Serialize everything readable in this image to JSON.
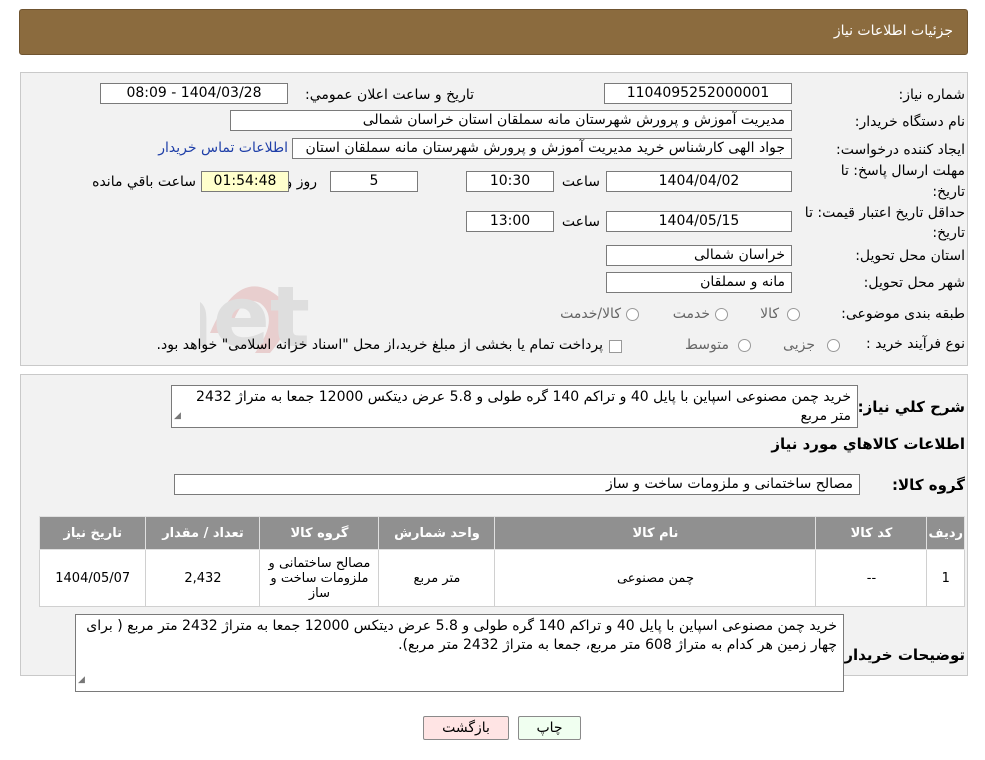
{
  "header": {
    "title": "جزئیات اطلاعات نیاز"
  },
  "need_number": {
    "label": "شماره نیاز:",
    "value": "1104095252000001"
  },
  "announce_datetime": {
    "label": "تاریخ و ساعت اعلان عمومي:",
    "value": "1404/03/28 - 08:09"
  },
  "buyer_org": {
    "label": "نام دستگاه خريدار:",
    "value": "مدیریت آموزش و پرورش شهرستان مانه سملقان استان خراسان شمالی"
  },
  "requester": {
    "label": "ایجاد کننده درخواست:",
    "value": "جواد الهی کارشناس خرید مدیریت آموزش و پرورش شهرستان مانه سملقان استان",
    "contact_link": "اطلاعات تماس خریدار"
  },
  "reply_deadline": {
    "label_line1": "مهلت ارسال پاسخ: تا",
    "label_line2": "تاریخ:",
    "date": "1404/04/02",
    "time_label": "ساعت",
    "time": "10:30",
    "days": "5",
    "days_label": "روز و",
    "remaining": "01:54:48",
    "remaining_label": "ساعت باقي مانده"
  },
  "price_validity": {
    "label_line1": "حداقل تاریخ اعتبار قیمت: تا",
    "label_line2": "تاریخ:",
    "date": "1404/05/15",
    "time_label": "ساعت",
    "time": "13:00"
  },
  "delivery_province": {
    "label": "استان محل تحویل:",
    "value": "خراسان شمالی"
  },
  "delivery_city": {
    "label": "شهر محل تحویل:",
    "value": "مانه و سملقان"
  },
  "category": {
    "label": "طبقه بندی موضوعی:",
    "options": [
      "کالا",
      "خدمت",
      "کالا/خدمت"
    ]
  },
  "purchase_process": {
    "label": "نوع فرآیند خرید :",
    "options": [
      "جزیی",
      "متوسط"
    ],
    "note": "پرداخت تمام یا بخشی از مبلغ خرید،از محل \"اسناد خزانه اسلامی\" خواهد بود."
  },
  "general_description": {
    "label": "شرح کلي نياز:",
    "value": "خرید چمن مصنوعی اسپاین با پایل 40 و تراکم 140 گره طولی و 5.8 عرض دیتکس 12000 جمعا به متراژ 2432 متر مربع"
  },
  "items_section_title": "اطلاعات کالاهاي مورد نياز",
  "goods_group": {
    "label": "گروه کالا:",
    "value": "مصالح ساختمانی و ملزومات ساخت و ساز"
  },
  "table": {
    "headers": [
      "رديف",
      "کد کالا",
      "نام کالا",
      "واحد شمارش",
      "گروه کالا",
      "تعداد / مقدار",
      "تاريخ نياز"
    ],
    "rows": [
      [
        "1",
        "--",
        "چمن مصنوعی",
        "متر مربع",
        "مصالح ساختمانی و ملزومات ساخت و ساز",
        "2,432",
        "1404/05/07"
      ]
    ]
  },
  "buyer_notes": {
    "label": "توضیحات خریدار:",
    "value": "خرید چمن مصنوعی اسپاین با پایل 40 و تراکم 140 گره طولی و 5.8 عرض دیتکس 12000 جمعا به متراژ 2432 متر مربع ( برای چهار زمین هر کدام به متراژ 608 متر مربع، جمعا به متراژ 2432 متر مربع)."
  },
  "buttons": {
    "print": "چاپ",
    "back": "بازگشت"
  },
  "watermark_text": "AriaTender.net",
  "colors": {
    "header": "#8b6b3e",
    "table_header": "#909090",
    "link": "#1f3fa8"
  }
}
